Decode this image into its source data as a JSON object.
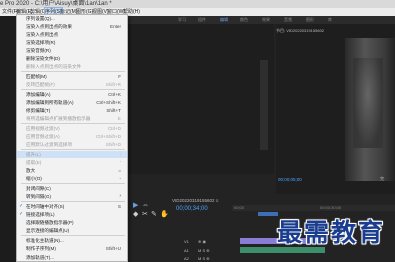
{
  "window": {
    "title": "e Pro 2020 - C:\\用户\\Aisuy\\桌面\\1an\\1an *"
  },
  "menubar": {
    "items": [
      {
        "label": "文件(F)"
      },
      {
        "label": "编辑(E)"
      },
      {
        "label": "剪辑(C)"
      },
      {
        "label": "序列(S)"
      },
      {
        "label": "标记(M)"
      },
      {
        "label": "图形(G)"
      },
      {
        "label": "视图(V)"
      },
      {
        "label": "窗口(W)"
      },
      {
        "label": "帮助(H)"
      }
    ]
  },
  "workspace_tabs": [
    "学习",
    "组件",
    "编辑",
    "颜色",
    "效果",
    "音频",
    "图形",
    "库"
  ],
  "program_monitor": {
    "title": "节目: VID20220319155602",
    "timecode": "00;00;05;00",
    "indicator": "完"
  },
  "timeline": {
    "title": "VID20220319155602 ≡",
    "timecode": "00;00;34;00",
    "ruler": [
      "00;00",
      "00;00;30;00"
    ],
    "tracks": [
      {
        "name": "V1",
        "controls": "⊕ ◉"
      },
      {
        "name": "A1",
        "controls": "M S ⊕"
      },
      {
        "name": "A2",
        "controls": "M S ⊕"
      }
    ]
  },
  "tools": [
    "▶",
    "⇔",
    "◆",
    "✂",
    "✎",
    "✋",
    "T"
  ],
  "sequence_menu": {
    "items": [
      {
        "label": "序列设置(Q)...",
        "shortcut": "",
        "disabled": false
      },
      {
        "label": "渲染入点到出点的效果",
        "shortcut": "Enter",
        "disabled": false
      },
      {
        "label": "渲染入点到出点",
        "shortcut": "",
        "disabled": false
      },
      {
        "label": "渲染选择项(R)",
        "shortcut": "",
        "disabled": false
      },
      {
        "label": "渲染音频(R)",
        "shortcut": "",
        "disabled": false
      },
      {
        "label": "删除渲染文件(D)",
        "shortcut": "",
        "disabled": false
      },
      {
        "label": "删除入点到出点的渲染文件",
        "shortcut": "",
        "disabled": true
      },
      {
        "sep": true
      },
      {
        "label": "匹配帧(M)",
        "shortcut": "F",
        "disabled": false
      },
      {
        "label": "反转匹配帧(F)",
        "shortcut": "Shift+R",
        "disabled": true
      },
      {
        "sep": true
      },
      {
        "label": "添加编辑(A)",
        "shortcut": "Ctrl+K",
        "disabled": false
      },
      {
        "label": "添加编辑到所有轨道(A)",
        "shortcut": "Ctrl+Shift+K",
        "disabled": false
      },
      {
        "label": "修剪编辑(T)",
        "shortcut": "Shift+T",
        "disabled": false
      },
      {
        "label": "将所选编辑点扩展到播放指示器",
        "shortcut": "E",
        "disabled": true
      },
      {
        "sep": true
      },
      {
        "label": "应用视频过渡(V)",
        "shortcut": "Ctrl+D",
        "disabled": true
      },
      {
        "label": "应用音频过渡(A)",
        "shortcut": "Ctrl+Shift+D",
        "disabled": true
      },
      {
        "label": "应用默认过渡到选择项",
        "shortcut": "Shift+D",
        "disabled": true
      },
      {
        "sep": true
      },
      {
        "label": "提升(L)",
        "shortcut": ";",
        "disabled": true
      },
      {
        "label": "提取(E)",
        "shortcut": "'",
        "disabled": true
      },
      {
        "label": "放大",
        "shortcut": "=",
        "disabled": false
      },
      {
        "label": "缩小(O)",
        "shortcut": "-",
        "disabled": false
      },
      {
        "sep": true
      },
      {
        "label": "封闭间隙(C)",
        "shortcut": "",
        "disabled": false
      },
      {
        "label": "转到间隔(G)",
        "shortcut": "",
        "disabled": false
      },
      {
        "sep": true
      },
      {
        "label": "在时间轴中对齐(S)",
        "shortcut": "S",
        "disabled": false,
        "checked": true
      },
      {
        "label": "链接选择项(L)",
        "shortcut": "",
        "disabled": false,
        "checked": true
      },
      {
        "label": "选择跟随播放指示器(P)",
        "shortcut": "",
        "disabled": false
      },
      {
        "label": "显示连接的编辑点(U)",
        "shortcut": "",
        "disabled": false
      },
      {
        "sep": true
      },
      {
        "label": "标准化主轨道(N)...",
        "shortcut": "",
        "disabled": false
      },
      {
        "label": "制作子序列(M)",
        "shortcut": "Shift+U",
        "disabled": false
      },
      {
        "sep": true
      },
      {
        "label": "自动重构序列(A)...",
        "shortcut": "",
        "disabled": false
      },
      {
        "label": "添加轨道(T)...",
        "shortcut": "",
        "disabled": false
      },
      {
        "label": "删除轨道(K)...",
        "shortcut": "",
        "disabled": false
      }
    ]
  },
  "watermark": {
    "text": "最需教育"
  },
  "colors": {
    "accent": "#4da3ff",
    "menu_highlight": "#cfe1f7",
    "watermark": "#1b3d8f"
  }
}
